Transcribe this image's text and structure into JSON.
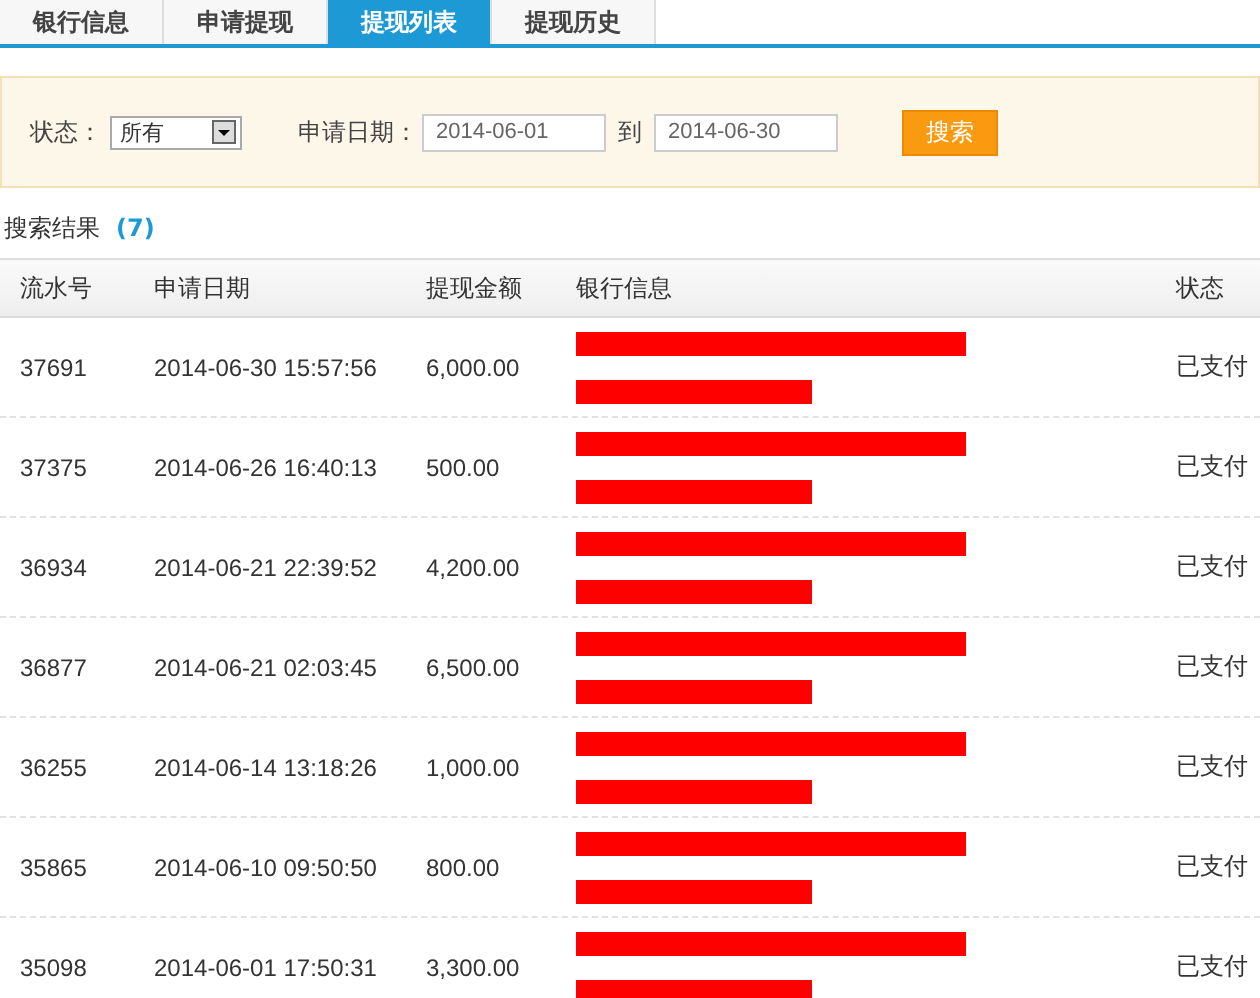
{
  "tabs": [
    {
      "label": "银行信息",
      "selected": false
    },
    {
      "label": "申请提现",
      "selected": false
    },
    {
      "label": "提现列表",
      "selected": true
    },
    {
      "label": "提现历史",
      "selected": false
    }
  ],
  "filter": {
    "status_label": "状态：",
    "status_value": "所有",
    "date_label": "申请日期：",
    "date_from": "2014-06-01",
    "to_label": "到",
    "date_to": "2014-06-30",
    "search_button": "搜索"
  },
  "results": {
    "title": "搜索结果",
    "count": "(7)"
  },
  "table": {
    "columns": [
      "流水号",
      "申请日期",
      "提现金额",
      "银行信息",
      "状态"
    ],
    "rows": [
      [
        "37691",
        "2014-06-30 15:57:56",
        "6,000.00",
        "已支付"
      ],
      [
        "37375",
        "2014-06-26 16:40:13",
        "500.00",
        "已支付"
      ],
      [
        "36934",
        "2014-06-21 22:39:52",
        "4,200.00",
        "已支付"
      ],
      [
        "36877",
        "2014-06-21 02:03:45",
        "6,500.00",
        "已支付"
      ],
      [
        "36255",
        "2014-06-14 13:18:26",
        "1,000.00",
        "已支付"
      ],
      [
        "35865",
        "2014-06-10 09:50:50",
        "800.00",
        "已支付"
      ],
      [
        "35098",
        "2014-06-01 17:50:31",
        "3,300.00",
        "已支付"
      ]
    ]
  }
}
